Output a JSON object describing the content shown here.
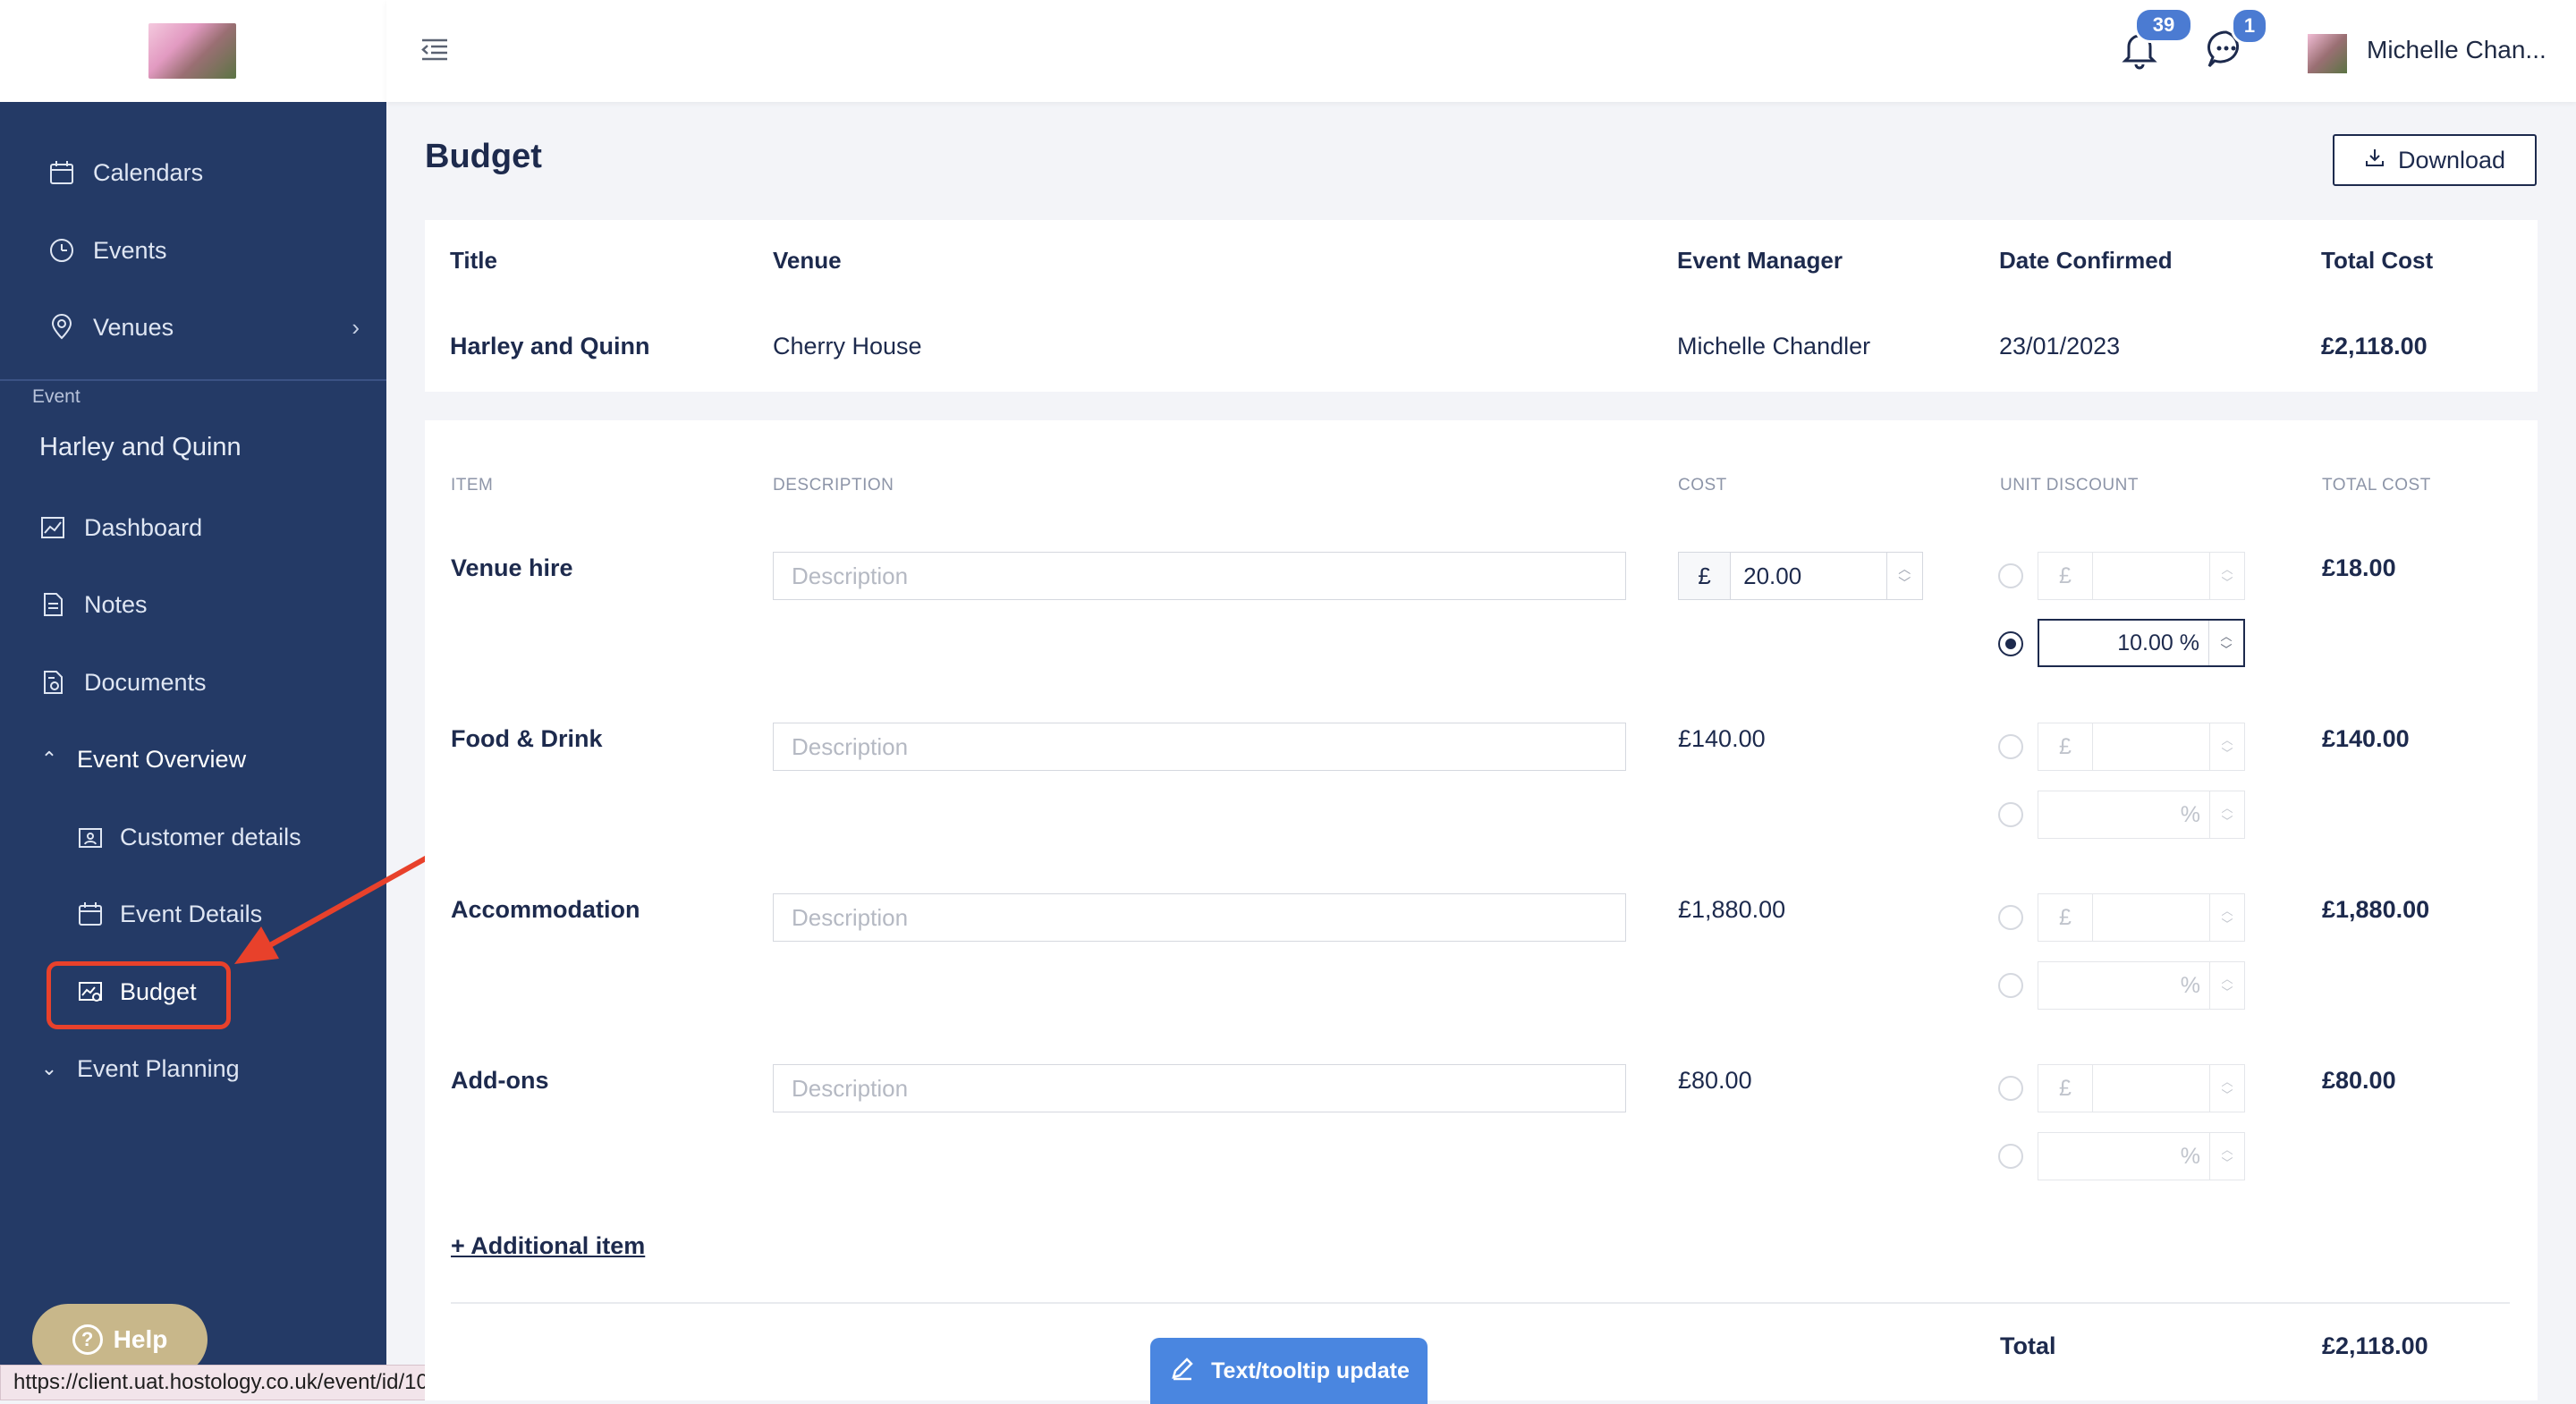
{
  "sidebar": {
    "top_items": [
      {
        "label": "Calendars",
        "icon": "calendar-icon"
      },
      {
        "label": "Events",
        "icon": "clock-icon"
      },
      {
        "label": "Venues",
        "icon": "location-pin-icon"
      }
    ],
    "section_caption": "Event",
    "event_name": "Harley and Quinn",
    "event_items": [
      {
        "label": "Dashboard",
        "icon": "chart-icon"
      },
      {
        "label": "Notes",
        "icon": "note-icon"
      },
      {
        "label": "Documents",
        "icon": "document-icon"
      }
    ],
    "event_overview": {
      "label": "Event Overview",
      "children": [
        {
          "label": "Customer details",
          "icon": "id-card-icon"
        },
        {
          "label": "Event Details",
          "icon": "calendar-icon"
        },
        {
          "label": "Budget",
          "icon": "budget-icon",
          "active": true
        }
      ]
    },
    "event_planning": {
      "label": "Event Planning"
    },
    "help_label": "Help",
    "status_url": "https://client.uat.hostology.co.uk/event/id/10pwd1/budget"
  },
  "topbar": {
    "notifications_count": "39",
    "messages_count": "1",
    "user_name": "Michelle Chan..."
  },
  "page": {
    "title": "Budget",
    "download_label": "Download"
  },
  "summary": {
    "headers": {
      "title": "Title",
      "venue": "Venue",
      "event_manager": "Event Manager",
      "date_confirmed": "Date Confirmed",
      "total_cost": "Total Cost"
    },
    "values": {
      "title": "Harley and Quinn",
      "venue": "Cherry House",
      "event_manager": "Michelle Chandler",
      "date_confirmed": "23/01/2023",
      "total_cost": "£2,118.00"
    }
  },
  "budget": {
    "columns": {
      "item": "ITEM",
      "description": "DESCRIPTION",
      "cost": "COST",
      "unit_discount": "UNIT DISCOUNT",
      "total_cost": "TOTAL COST"
    },
    "description_placeholder": "Description",
    "currency_symbol": "£",
    "percent_symbol": "%",
    "rows": [
      {
        "item": "Venue hire",
        "cost_input": "20.00",
        "percent_value": "10.00 %",
        "total": "£18.00"
      },
      {
        "item": "Food & Drink",
        "cost": "£140.00",
        "total": "£140.00"
      },
      {
        "item": "Accommodation",
        "cost": "£1,880.00",
        "total": "£1,880.00"
      },
      {
        "item": "Add-ons",
        "cost": "£80.00",
        "total": "£80.00"
      }
    ],
    "add_item_label": "+ Additional item",
    "total_label": "Total",
    "grand_total": "£2,118.00"
  },
  "tooltip_update_label": "Text/tooltip update",
  "colors": {
    "sidebar": "#243a66",
    "accent": "#4b7bd2",
    "highlight": "#e8412b",
    "help": "#c8b78a"
  }
}
